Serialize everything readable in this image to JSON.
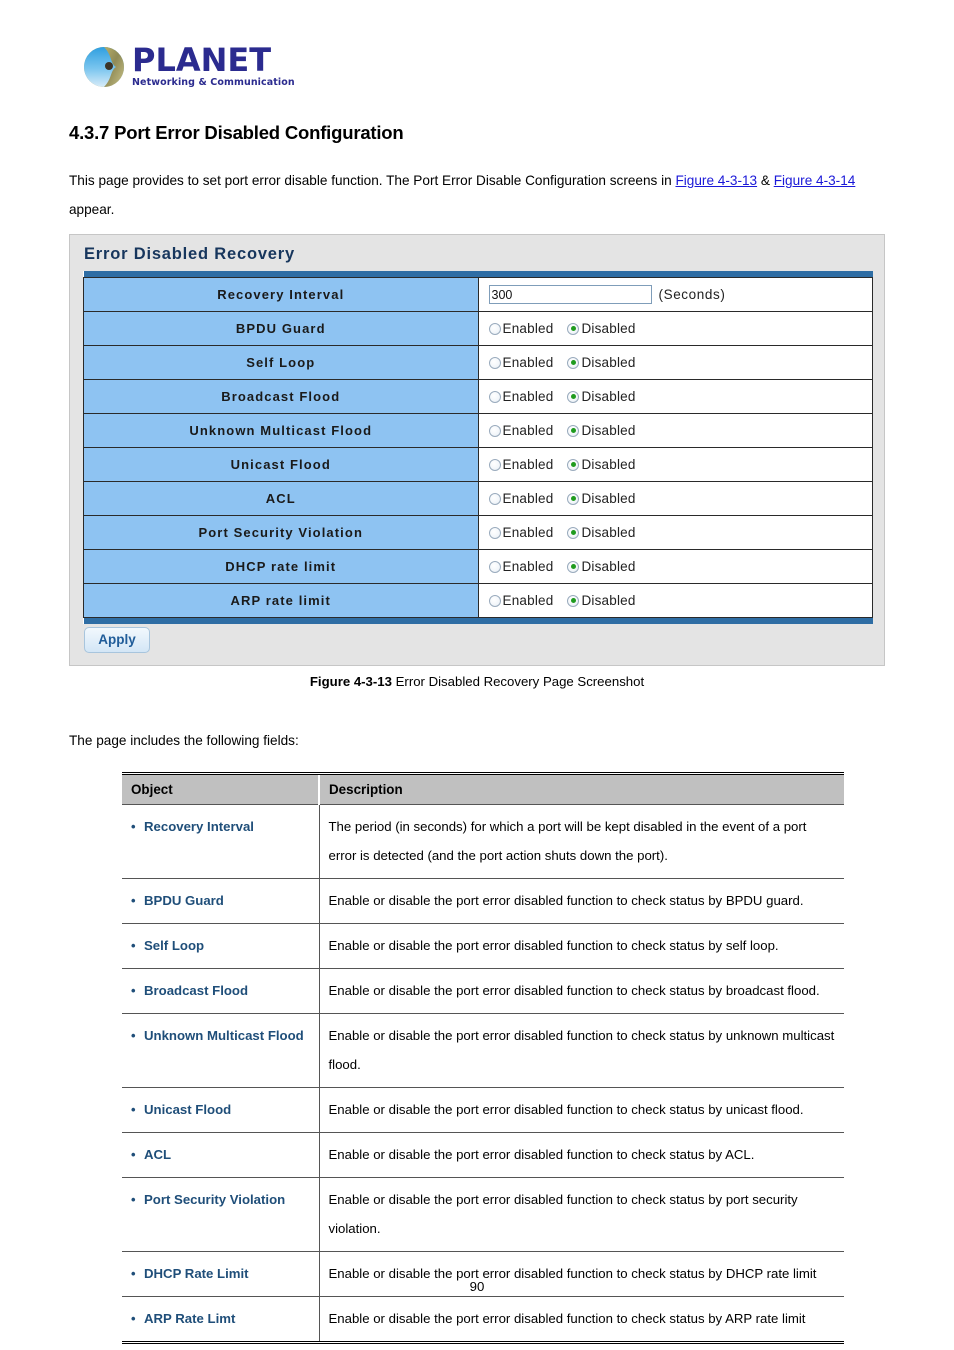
{
  "logo": {
    "name": "PLANET",
    "tagline": "Networking & Communication"
  },
  "heading": "4.3.7 Port Error Disabled Configuration",
  "intro": {
    "part1": "This page provides to set port error disable function. The Port Error Disable Configuration screens in ",
    "link1": "Figure 4-3-13",
    "amp": " & ",
    "link2": "Figure 4-3-14",
    "part2": " appear."
  },
  "panel": {
    "title": "Error Disabled Recovery",
    "recovery_interval_label": "Recovery Interval",
    "recovery_interval_value": "300",
    "seconds_label": "(Seconds)",
    "enabled_label": "Enabled",
    "disabled_label": "Disabled",
    "apply_label": "Apply",
    "rows": [
      {
        "label": "BPDU Guard",
        "selected": "Disabled"
      },
      {
        "label": "Self Loop",
        "selected": "Disabled"
      },
      {
        "label": "Broadcast Flood",
        "selected": "Disabled"
      },
      {
        "label": "Unknown Multicast Flood",
        "selected": "Disabled"
      },
      {
        "label": "Unicast Flood",
        "selected": "Disabled"
      },
      {
        "label": "ACL",
        "selected": "Disabled"
      },
      {
        "label": "Port Security Violation",
        "selected": "Disabled"
      },
      {
        "label": "DHCP rate limit",
        "selected": "Disabled"
      },
      {
        "label": "ARP rate limit",
        "selected": "Disabled"
      }
    ]
  },
  "caption": {
    "bold": "Figure 4-3-13",
    "rest": " Error Disabled Recovery Page Screenshot"
  },
  "fields_note": "The page includes the following fields:",
  "desc_table": {
    "headers": {
      "object": "Object",
      "description": "Description"
    },
    "rows": [
      {
        "object": "Recovery Interval",
        "description": "The period (in seconds) for which a port will be kept disabled in the event of a port error is detected (and the port action shuts down the port)."
      },
      {
        "object": "BPDU Guard",
        "description": "Enable or disable the port error disabled function to check status by BPDU guard."
      },
      {
        "object": "Self Loop",
        "description": "Enable or disable the port error disabled function to check status by self loop."
      },
      {
        "object": "Broadcast Flood",
        "description": "Enable or disable the port error disabled function to check status by broadcast flood."
      },
      {
        "object": "Unknown Multicast Flood",
        "description": "Enable or disable the port error disabled function to check status by unknown multicast flood."
      },
      {
        "object": "Unicast Flood",
        "description": "Enable or disable the port error disabled function to check status by unicast flood."
      },
      {
        "object": "ACL",
        "description": "Enable or disable the port error disabled function to check status by ACL."
      },
      {
        "object": "Port Security Violation",
        "description": "Enable or disable the port error disabled function to check status by port security violation."
      },
      {
        "object": "DHCP Rate Limit",
        "description": "Enable or disable the port error disabled function to check status by DHCP rate limit"
      },
      {
        "object": "ARP Rate Limt",
        "description": "Enable or disable the port error disabled function to check status by ARP rate limit"
      }
    ]
  },
  "page_number": "90",
  "colors": {
    "link": "#1a18d8",
    "panel_title": "#17365d",
    "row_label_bg": "#8ec3f2",
    "bar_blue": "#2e6da4",
    "object_text": "#1f4e79",
    "radio_selected": "#1f9b1f"
  }
}
